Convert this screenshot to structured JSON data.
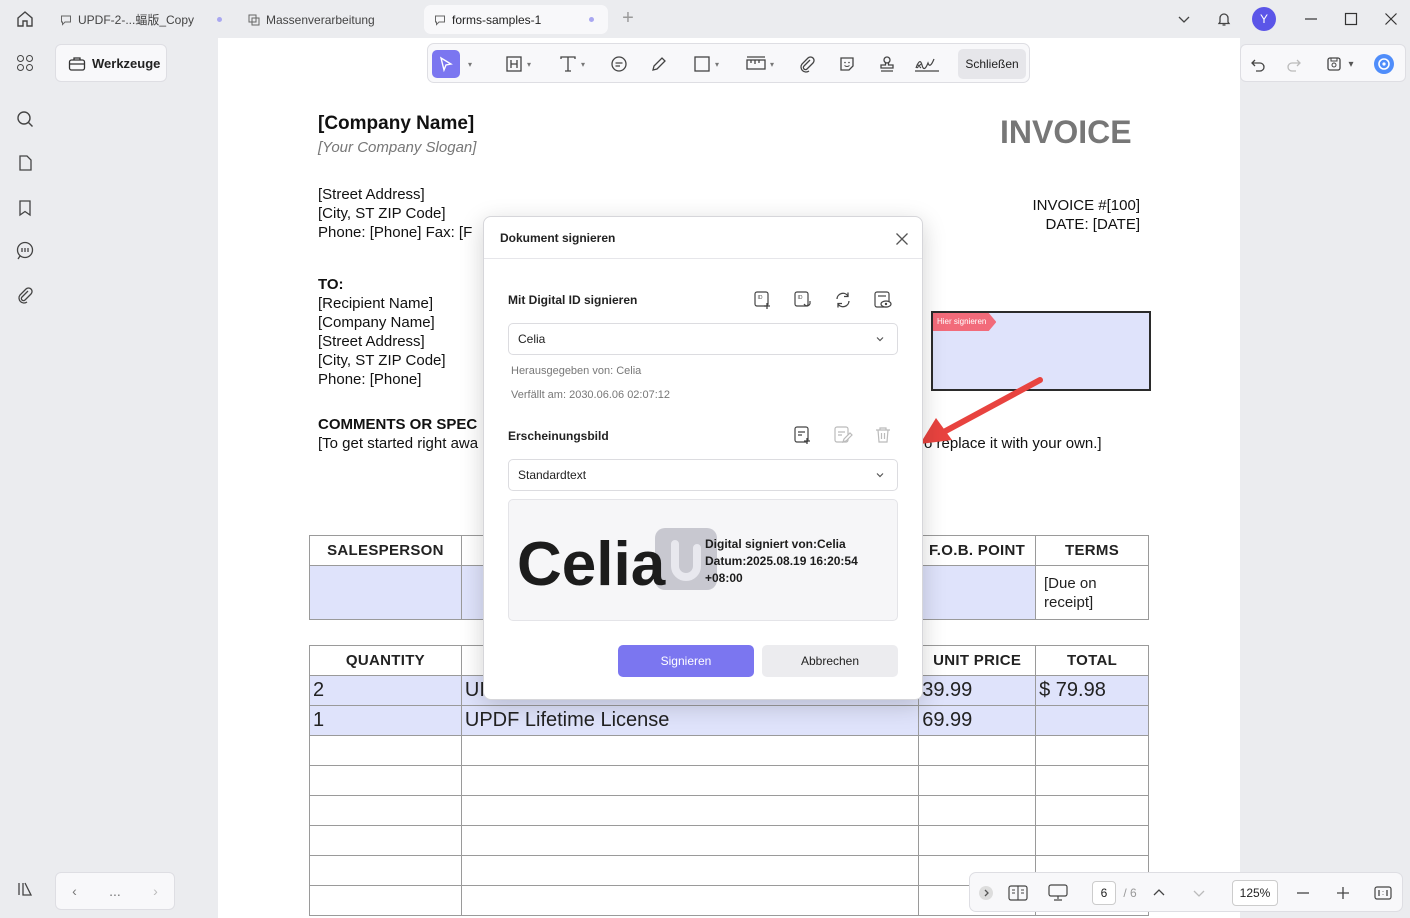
{
  "tabs": [
    {
      "label": "UPDF-2-...蝠版_Copy"
    },
    {
      "label": "Massenverarbeitung"
    },
    {
      "label": "forms-samples-1"
    }
  ],
  "user": {
    "avatar_letter": "Y"
  },
  "left_panel": {
    "tools_label": "Werkzeuge",
    "pager_more": "..."
  },
  "toolbar": {
    "close_label": "Schließen"
  },
  "document": {
    "company": "[Company Name]",
    "slogan": "[Your Company Slogan]",
    "address": [
      "[Street Address]",
      "[City, ST ZIP Code]",
      "Phone: [Phone]  Fax: [F"
    ],
    "invoice_title": "INVOICE",
    "invoice_number": "INVOICE #[100]",
    "invoice_date": "DATE: [DATE]",
    "to_label": "TO:",
    "to_lines": [
      "[Recipient Name]",
      "[Company Name]",
      "[Street Address]",
      "[City, ST ZIP Code]",
      "Phone: [Phone]"
    ],
    "comments_label": "COMMENTS OR SPEC",
    "comments_text": "[To get started right awa",
    "comments_tail": "o replace it with your own.]",
    "sign_here": "Hier signieren",
    "top_table": {
      "headers": [
        "SALESPERSON",
        "",
        "F.O.B. POINT",
        "TERMS"
      ],
      "terms_value": "[Due on receipt]"
    },
    "bottom_table": {
      "headers": [
        "QUANTITY",
        "",
        "UNIT PRICE",
        "TOTAL"
      ],
      "rows": [
        {
          "qty": "2",
          "desc": "UI",
          "price": "39.99",
          "total": "$ 79.98"
        },
        {
          "qty": "1",
          "desc": "UPDF Lifetime License",
          "price": "69.99",
          "total": ""
        }
      ]
    }
  },
  "dialog": {
    "title": "Dokument signieren",
    "digital_id_label": "Mit Digital ID signieren",
    "digital_id_selected": "Celia",
    "issued_by": "Herausgegeben von: Celia",
    "expires": "Verfällt am: 2030.06.06 02:07:12",
    "appearance_label": "Erscheinungsbild",
    "appearance_selected": "Standardtext",
    "preview_name": "Celia",
    "preview_line1": "Digital signiert von:Celia",
    "preview_line2": "Datum:2025.08.19 16:20:54",
    "preview_line3": "+08:00",
    "sign_button": "Signieren",
    "cancel_button": "Abbrechen"
  },
  "zoombar": {
    "page_current": "6",
    "page_total": "/ 6",
    "zoom": "125%"
  },
  "colors": {
    "accent": "#7b76f0",
    "highlight": "#dfe3fb",
    "sign_tag": "#f26b7a",
    "arrow": "#e8433f"
  }
}
